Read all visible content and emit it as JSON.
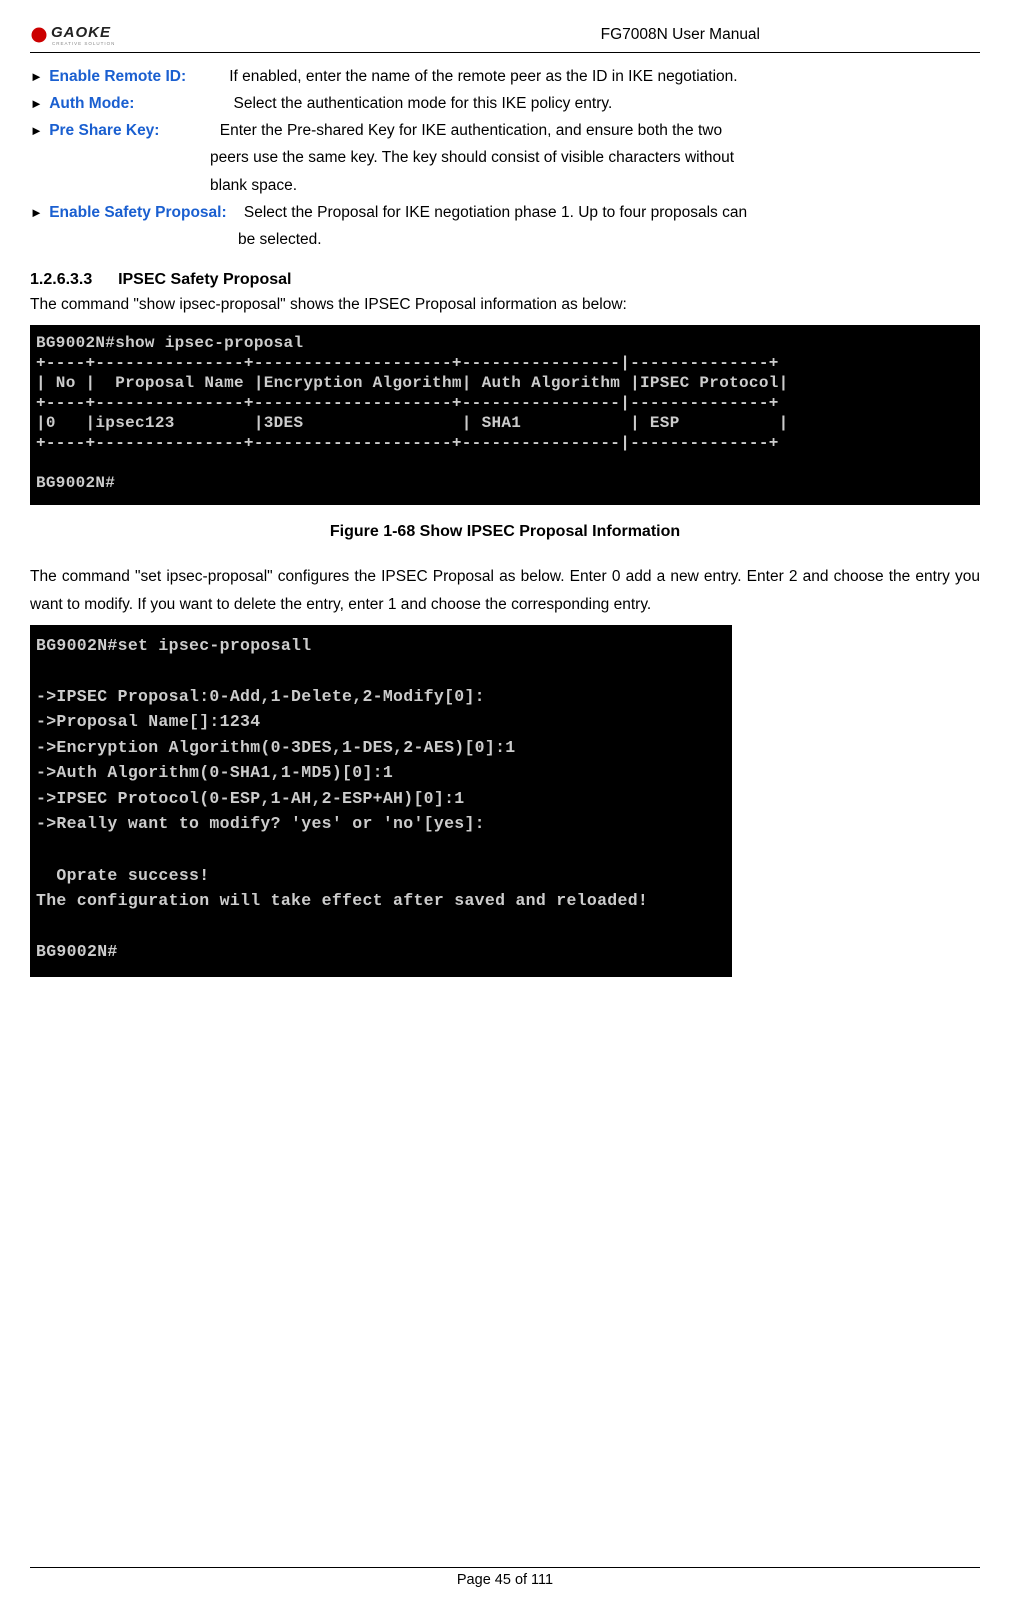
{
  "header": {
    "logo_main": "GAOKE",
    "logo_sub": "CREATIVE SOLUTION",
    "manual_title": "FG7008N User Manual"
  },
  "definitions": [
    {
      "label": "Enable Remote ID:",
      "text_first": "If enabled, enter the name of the remote peer as the ID in IKE negotiation.",
      "cont": []
    },
    {
      "label": "Auth Mode:",
      "text_first": "Select the authentication mode for this IKE policy entry.",
      "cont": []
    },
    {
      "label": "Pre Share Key:",
      "text_first": "Enter the Pre-shared Key for IKE authentication, and ensure both the two",
      "cont": [
        "peers use the same key. The key should consist of visible characters without",
        "blank space."
      ]
    },
    {
      "label": "Enable Safety Proposal:",
      "text_first": "Select the Proposal for IKE negotiation phase 1. Up to four proposals can",
      "cont": [
        "be selected."
      ]
    }
  ],
  "section": {
    "number": "1.2.6.3.3",
    "title": "IPSEC Safety Proposal"
  },
  "para1": "The command \"show ipsec-proposal\" shows the IPSEC Proposal information as below:",
  "terminal1": "BG9002N#show ipsec-proposal\n+----+---------------+--------------------+----------------|--------------+\n| No |  Proposal Name |Encryption Algorithm| Auth Algorithm |IPSEC Protocol|\n+----+---------------+--------------------+----------------|--------------+\n|0   |ipsec123        |3DES                | SHA1           | ESP          |\n+----+---------------+--------------------+----------------|--------------+\n\nBG9002N#",
  "fig1_caption": "Figure 1-68   Show IPSEC Proposal Information",
  "para2": "The command \"set ipsec-proposal\" configures the IPSEC Proposal as below. Enter 0 add a new entry. Enter 2 and choose the entry you want to modify. If you want to delete the entry, enter 1 and choose the corresponding entry.",
  "terminal2": "BG9002N#set ipsec-proposall\n\n->IPSEC Proposal:0-Add,1-Delete,2-Modify[0]:\n->Proposal Name[]:1234\n->Encryption Algorithm(0-3DES,1-DES,2-AES)[0]:1\n->Auth Algorithm(0-SHA1,1-MD5)[0]:1\n->IPSEC Protocol(0-ESP,1-AH,2-ESP+AH)[0]:1\n->Really want to modify? 'yes' or 'no'[yes]:\n\n  Oprate success!\nThe configuration will take effect after saved and reloaded!\n\nBG9002N#",
  "footer": "Page 45 of 111",
  "chart_data": {
    "type": "table",
    "title": "IPSEC Proposal Information",
    "columns": [
      "No",
      "Proposal Name",
      "Encryption Algorithm",
      "Auth Algorithm",
      "IPSEC Protocol"
    ],
    "rows": [
      [
        "0",
        "ipsec123",
        "3DES",
        "SHA1",
        "ESP"
      ]
    ]
  }
}
